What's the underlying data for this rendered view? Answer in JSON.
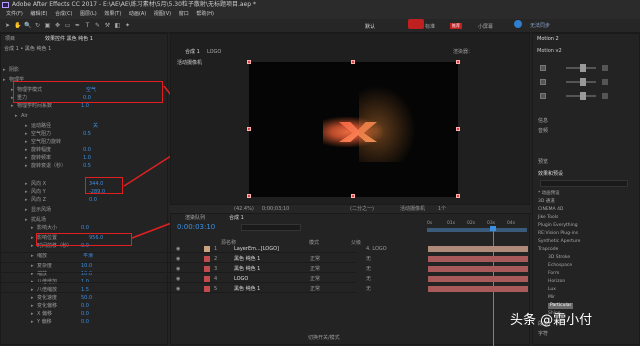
{
  "app": {
    "title": "Adobe After Effects CC 2017 - E:\\AE\\AE\\练习素材\\5月\\5.30粒子散射\\无标题项目.aep *"
  },
  "menu": [
    "文件(F)",
    "编辑(E)",
    "合成(C)",
    "图层(L)",
    "效果(T)",
    "动画(A)",
    "视图(V)",
    "窗口",
    "帮助(H)"
  ],
  "topbar": {
    "tabs": [
      "默认",
      "标准",
      "小屏幕"
    ],
    "sync_label": "无法同步",
    "tag": "推荐"
  },
  "left_panel": {
    "tabs": [
      "项目",
      "效果控件 黑色 纯色 1"
    ],
    "breadcrumb": "合成 1 • 黑色 纯色 1",
    "rows": [
      {
        "label": "阴影",
        "value": ""
      },
      {
        "label": "物理学",
        "value": ""
      },
      {
        "label": "物理学模式",
        "value": "空气"
      },
      {
        "label": "重力",
        "value": "0.0"
      },
      {
        "label": "物理学时间系数",
        "value": "1.0"
      },
      {
        "label": "Air",
        "value": ""
      },
      {
        "label": "运动路径",
        "value": "关"
      },
      {
        "label": "空气阻力",
        "value": "0.5"
      },
      {
        "label": "空气阻力旋转",
        "value": ""
      },
      {
        "label": "旋转幅度",
        "value": "0.0"
      },
      {
        "label": "旋转频率",
        "value": "1.0"
      },
      {
        "label": "旋转衰退（秒）",
        "value": "0.5"
      },
      {
        "label": "风向 X",
        "value": "344.0"
      },
      {
        "label": "风向 Y",
        "value": "-289.0"
      },
      {
        "label": "风向 Z",
        "value": "0.0"
      },
      {
        "label": "显示风场",
        "value": ""
      },
      {
        "label": "扰乱场",
        "value": ""
      },
      {
        "label": "影响大小",
        "value": "0.0"
      },
      {
        "label": "影响位置",
        "value": "956.0"
      },
      {
        "label": "时间前移（秒）",
        "value": "0.0"
      },
      {
        "label": "缩放",
        "value": "平滑"
      },
      {
        "label": "复杂度",
        "value": "10.0"
      },
      {
        "label": "缩放",
        "value": "10.0"
      },
      {
        "label": "八倍增加",
        "value": "1.0"
      },
      {
        "label": "八倍缩放",
        "value": "1.5"
      },
      {
        "label": "变化速度",
        "value": "50.0"
      },
      {
        "label": "变化偏移",
        "value": "0.0"
      },
      {
        "label": "X 偏移",
        "value": "0.0"
      },
      {
        "label": "Y 偏移",
        "value": "0.0"
      }
    ]
  },
  "viewer": {
    "tabs": [
      "合成 1",
      "LOGO"
    ],
    "label": "活动摄像机",
    "zoom": "(42.4%)",
    "timecode": "0;00;03;10",
    "quality": "(二分之一)",
    "camera": "活动摄像机",
    "views": "1个"
  },
  "timeline": {
    "tabs": [
      "渲染队列",
      "合成 1"
    ],
    "timecode": "0:00:03:10",
    "search_placeholder": "",
    "header": {
      "name": "源名称",
      "mode": "模式",
      "parent": "父级"
    },
    "ruler": [
      "0s",
      "01s",
      "02s",
      "03s",
      "04s"
    ],
    "layers": [
      {
        "num": "1",
        "name": "LayerEm...[LOGO]",
        "mode": "",
        "parent": "4. LOGO",
        "color": "#caa47e"
      },
      {
        "num": "2",
        "name": "黑色 纯色 1",
        "mode": "正常",
        "parent": "无",
        "color": "#c14a4a"
      },
      {
        "num": "3",
        "name": "黑色 纯色 1",
        "mode": "正常",
        "parent": "无",
        "color": "#c14a4a"
      },
      {
        "num": "4",
        "name": "LOGO",
        "mode": "正常",
        "parent": "无",
        "color": "#c14a4a"
      },
      {
        "num": "5",
        "name": "黑色 纯色 1",
        "mode": "正常",
        "parent": "无",
        "color": "#c14a4a"
      }
    ],
    "footer": "切换开关/模式"
  },
  "right_panel": {
    "motion_tab": "Motion 2",
    "motion_value": "Motion v2",
    "sections": [
      "信息",
      "音频",
      "预览",
      "效果和预设",
      "段落",
      "字符"
    ],
    "effects_search": "",
    "effects": [
      "* 动画预设",
      "3D 通道",
      "CINEMA 4D",
      "Jike Tools",
      "Plugin Everything",
      "RE:Vision Plug-ins",
      "Synthetic Aperture",
      "Trapcode",
      "3D Stroke",
      "Echospace",
      "Form",
      "Horizon",
      "Lux",
      "Mir",
      "Particular",
      "Shine"
    ],
    "selected_effect": "Particular"
  },
  "colors": {
    "accent": "#3d8fe0",
    "highlight": "#e02020",
    "layer_bar": "#a85a5a"
  },
  "watermark": {
    "prefix": "头条",
    "handle": "@霜小付"
  }
}
